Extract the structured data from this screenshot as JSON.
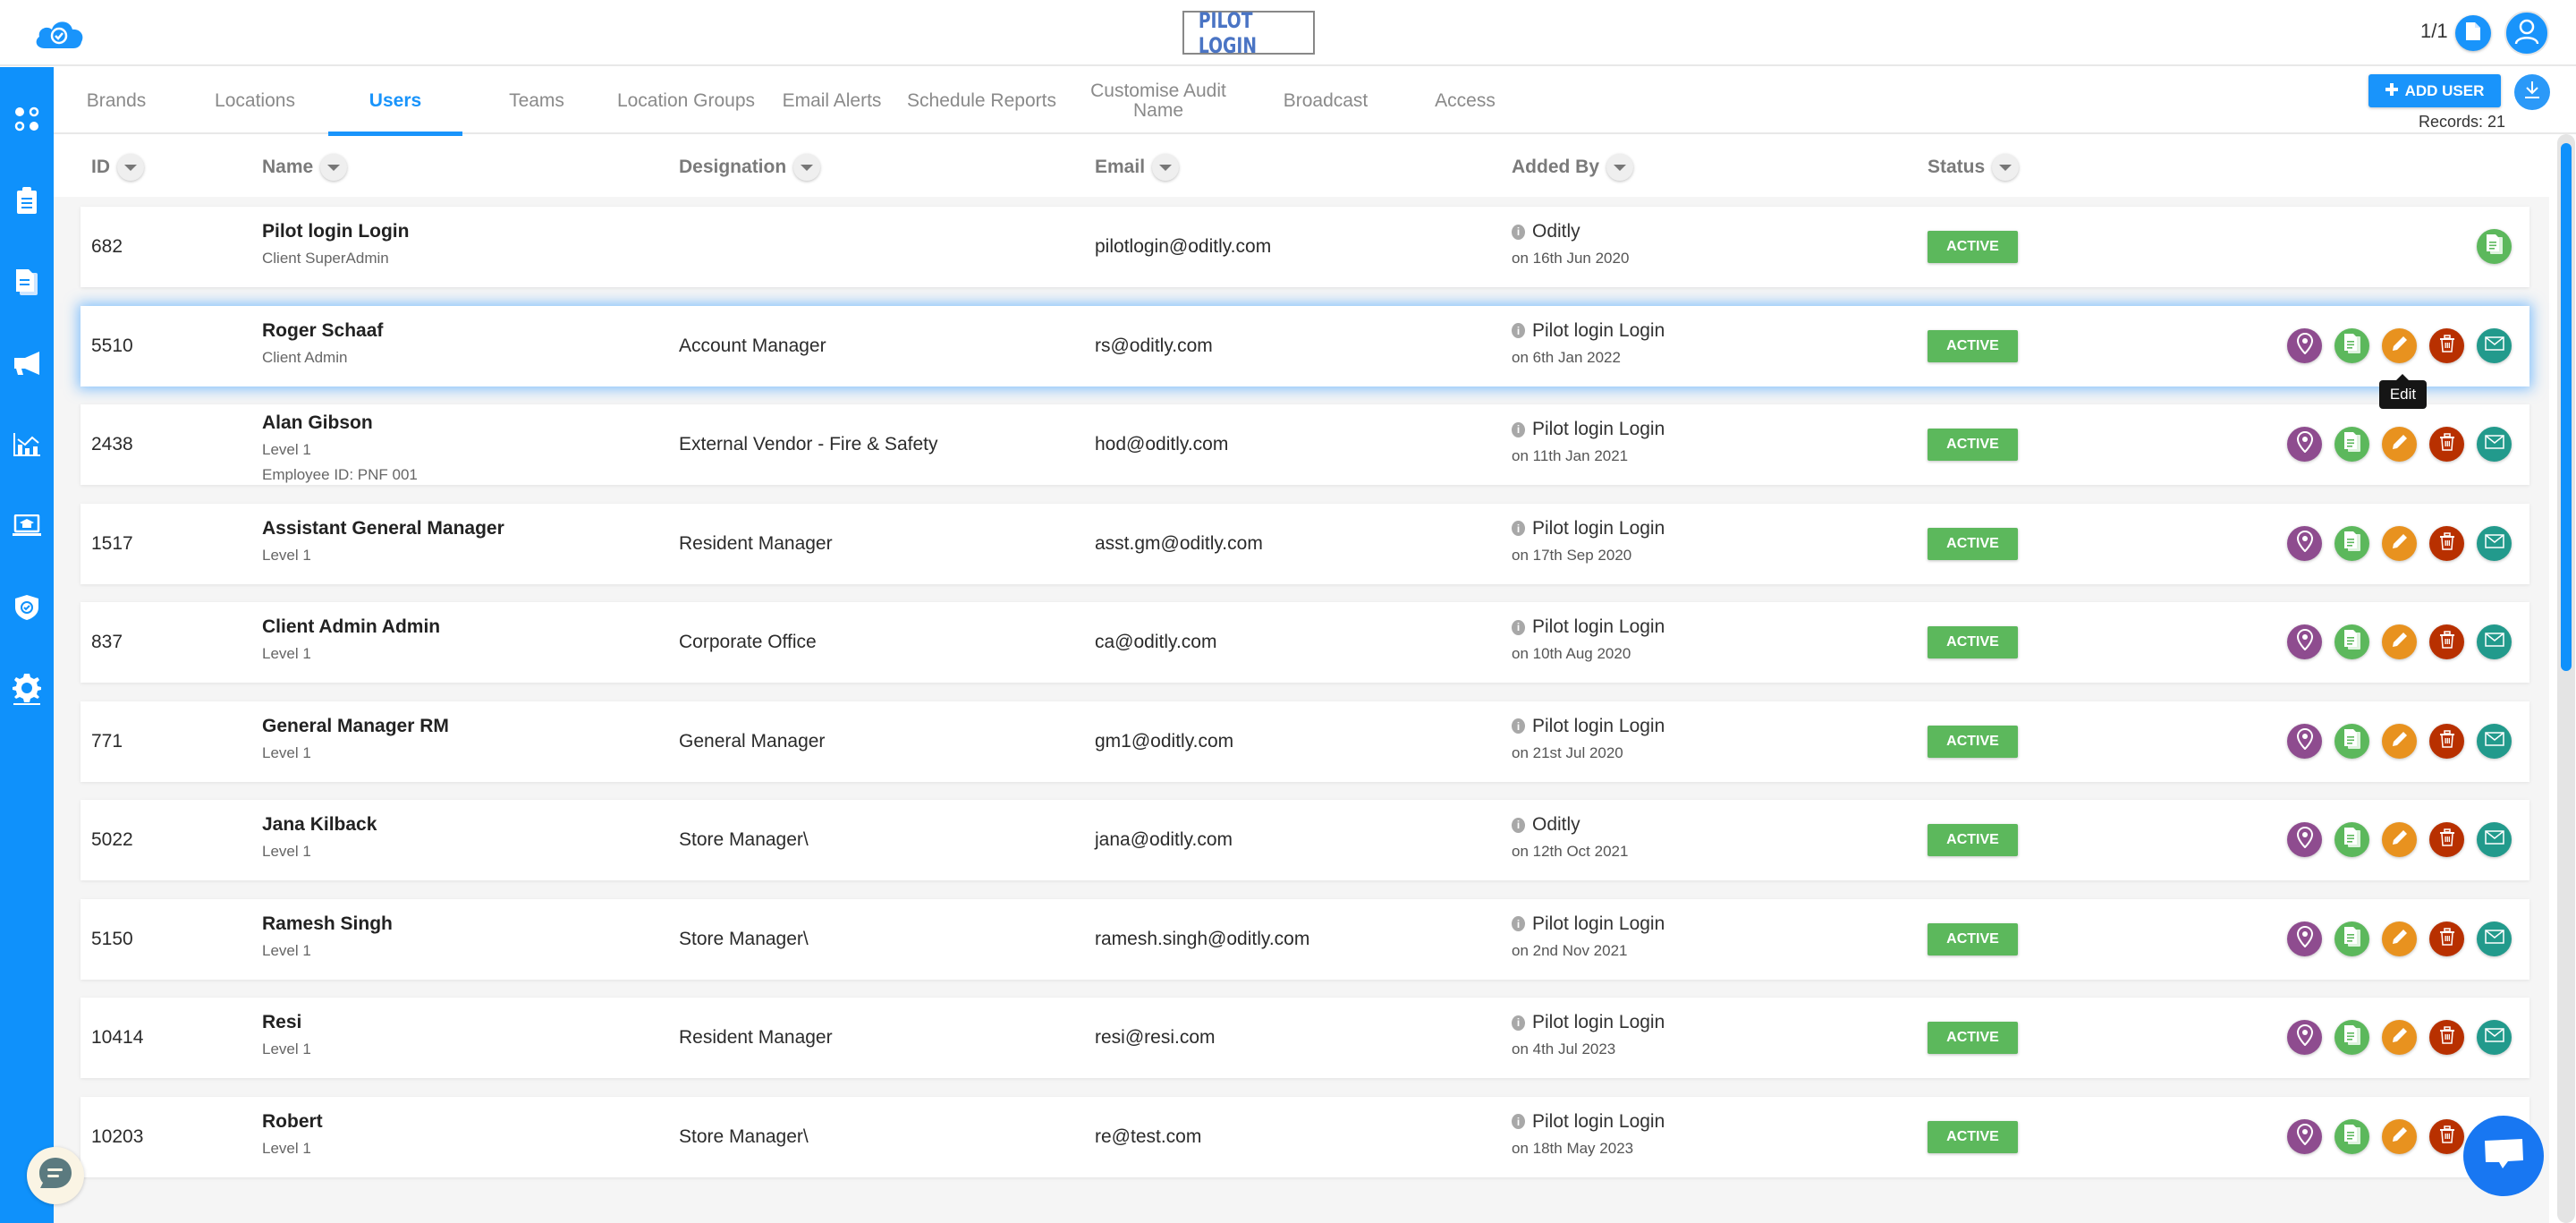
{
  "header": {
    "brand_label": "PILOT LOGIN",
    "page_count": "1/1"
  },
  "sidebar": {
    "items": [
      {
        "name": "dashboard",
        "icon": "apps-dots-icon"
      },
      {
        "name": "audits",
        "icon": "clipboard-icon"
      },
      {
        "name": "reports",
        "icon": "documents-icon"
      },
      {
        "name": "broadcast",
        "icon": "megaphone-icon"
      },
      {
        "name": "analytics",
        "icon": "chart-icon"
      },
      {
        "name": "training",
        "icon": "graduation-laptop-icon"
      },
      {
        "name": "compliance",
        "icon": "shield-check-icon"
      },
      {
        "name": "settings",
        "icon": "gear-icon",
        "active": true
      }
    ]
  },
  "tabs": [
    {
      "label": "Brands"
    },
    {
      "label": "Locations"
    },
    {
      "label": "Users",
      "active": true
    },
    {
      "label": "Teams"
    },
    {
      "label": "Location Groups"
    },
    {
      "label": "Email Alerts"
    },
    {
      "label": "Schedule Reports"
    },
    {
      "label": "Customise Audit Name"
    },
    {
      "label": "Broadcast"
    },
    {
      "label": "Access"
    }
  ],
  "toolbar": {
    "add_user_label": "ADD USER",
    "records_label": "Records: 21"
  },
  "table": {
    "columns": [
      "ID",
      "Name",
      "Designation",
      "Email",
      "Added By",
      "Status"
    ],
    "rows": [
      {
        "id": "682",
        "name": "Pilot login Login",
        "role": "Client SuperAdmin",
        "extra": "",
        "designation": "",
        "email": "pilotlogin@oditly.com",
        "added_by": "Oditly",
        "added_on": "on 16th Jun 2020",
        "status": "ACTIVE",
        "actions": [
          "documents"
        ]
      },
      {
        "id": "5510",
        "name": "Roger Schaaf",
        "role": "Client Admin",
        "extra": "",
        "designation": "Account Manager",
        "email": "rs@oditly.com",
        "added_by": "Pilot login Login",
        "added_on": "on 6th Jan 2022",
        "status": "ACTIVE",
        "actions": [
          "location",
          "documents",
          "edit",
          "delete",
          "email"
        ],
        "highlighted": true
      },
      {
        "id": "2438",
        "name": "Alan Gibson",
        "role": "Level 1",
        "extra": "Employee ID: PNF 001",
        "designation": "External Vendor - Fire & Safety",
        "email": "hod@oditly.com",
        "added_by": "Pilot login Login",
        "added_on": "on 11th Jan 2021",
        "status": "ACTIVE",
        "actions": [
          "location",
          "documents",
          "edit",
          "delete",
          "email"
        ]
      },
      {
        "id": "1517",
        "name": "Assistant General Manager",
        "role": "Level 1",
        "extra": "",
        "designation": "Resident Manager",
        "email": "asst.gm@oditly.com",
        "added_by": "Pilot login Login",
        "added_on": "on 17th Sep 2020",
        "status": "ACTIVE",
        "actions": [
          "location",
          "documents",
          "edit",
          "delete",
          "email"
        ]
      },
      {
        "id": "837",
        "name": "Client Admin Admin",
        "role": "Level 1",
        "extra": "",
        "designation": "Corporate Office",
        "email": "ca@oditly.com",
        "added_by": "Pilot login Login",
        "added_on": "on 10th Aug 2020",
        "status": "ACTIVE",
        "actions": [
          "location",
          "documents",
          "edit",
          "delete",
          "email"
        ]
      },
      {
        "id": "771",
        "name": "General Manager RM",
        "role": "Level 1",
        "extra": "",
        "designation": "General Manager",
        "email": "gm1@oditly.com",
        "added_by": "Pilot login Login",
        "added_on": "on 21st Jul 2020",
        "status": "ACTIVE",
        "actions": [
          "location",
          "documents",
          "edit",
          "delete",
          "email"
        ]
      },
      {
        "id": "5022",
        "name": "Jana Kilback",
        "role": "Level 1",
        "extra": "",
        "designation": "Store Manager\\",
        "email": "jana@oditly.com",
        "added_by": "Oditly",
        "added_on": "on 12th Oct 2021",
        "status": "ACTIVE",
        "actions": [
          "location",
          "documents",
          "edit",
          "delete",
          "email"
        ]
      },
      {
        "id": "5150",
        "name": "Ramesh Singh",
        "role": "Level 1",
        "extra": "",
        "designation": "Store Manager\\",
        "email": "ramesh.singh@oditly.com",
        "added_by": "Pilot login Login",
        "added_on": "on 2nd Nov 2021",
        "status": "ACTIVE",
        "actions": [
          "location",
          "documents",
          "edit",
          "delete",
          "email"
        ]
      },
      {
        "id": "10414",
        "name": "Resi",
        "role": "Level 1",
        "extra": "",
        "designation": "Resident Manager",
        "email": "resi@resi.com",
        "added_by": "Pilot login Login",
        "added_on": "on 4th Jul 2023",
        "status": "ACTIVE",
        "actions": [
          "location",
          "documents",
          "edit",
          "delete",
          "email"
        ]
      },
      {
        "id": "10203",
        "name": "Robert",
        "role": "Level 1",
        "extra": "",
        "designation": "Store Manager\\",
        "email": "re@test.com",
        "added_by": "Pilot login Login",
        "added_on": "on 18th May 2023",
        "status": "ACTIVE",
        "actions": [
          "location",
          "documents",
          "edit",
          "delete",
          "email"
        ]
      }
    ]
  },
  "tooltip": {
    "label": "Edit"
  },
  "colors": {
    "primary": "#0f91fb",
    "active_status": "#5cb85c",
    "location": "#8e4c8f",
    "documents": "#5cb85c",
    "edit": "#e8921f",
    "delete": "#b83000",
    "email": "#229a8c"
  }
}
